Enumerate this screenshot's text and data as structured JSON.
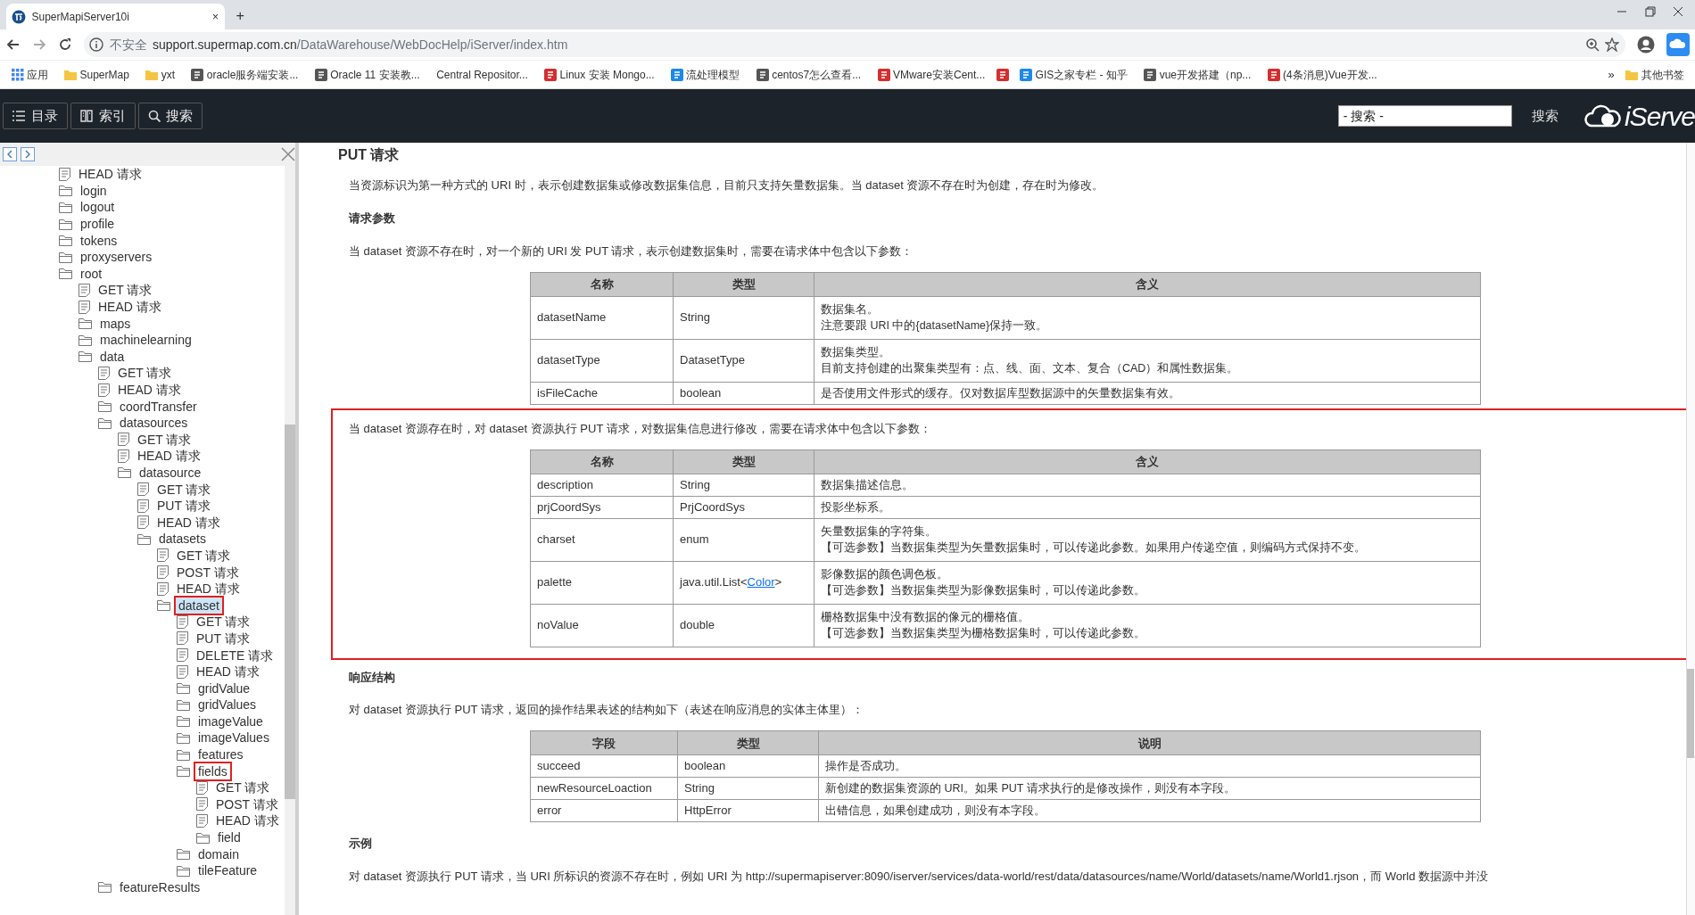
{
  "browser": {
    "tab": {
      "title": "SuperMapiServer10i",
      "close": "×",
      "new_tab": "+"
    },
    "address": {
      "security": "不安全",
      "host": "support.supermap.com.cn",
      "path": "/DataWarehouse/WebDocHelp/iServer/index.htm"
    },
    "bookmarks": [
      {
        "label": "应用",
        "kind": "apps"
      },
      {
        "label": "SuperMap",
        "kind": "folder"
      },
      {
        "label": "yxt",
        "kind": "folder"
      },
      {
        "label": "oracle服务端安装...",
        "kind": "gray"
      },
      {
        "label": "Oracle 11 安装教...",
        "kind": "gray"
      },
      {
        "label": "Central Repositor...",
        "kind": "none"
      },
      {
        "label": "Linux 安装 Mongo...",
        "kind": "red"
      },
      {
        "label": "流处理模型",
        "kind": "blue"
      },
      {
        "label": "centos7怎么查看...",
        "kind": "gray"
      },
      {
        "label": "VMware安装Cent...",
        "kind": "red"
      },
      {
        "kind": "red"
      },
      {
        "label": "GIS之家专栏 - 知乎",
        "kind": "blue"
      },
      {
        "label": "vue开发搭建（np...",
        "kind": "gray"
      },
      {
        "label": "(4条消息)Vue开发...",
        "kind": "red"
      }
    ],
    "more": "»",
    "other_bookmarks": "其他书签"
  },
  "toolbar": {
    "buttons": [
      {
        "label": "目录",
        "kind": "list"
      },
      {
        "label": "索引",
        "kind": "book"
      },
      {
        "label": "搜索",
        "kind": "search"
      }
    ],
    "search": {
      "placeholder": "- 搜索 -"
    },
    "search_button": "搜索",
    "logo": "iServe"
  },
  "sidebar": {
    "tree": [
      {
        "label": "HEAD 请求",
        "kind": "doc",
        "selected": false,
        "annotated": false
      },
      {
        "label": "login",
        "kind": "folder",
        "selected": false,
        "annotated": false
      },
      {
        "label": "logout",
        "kind": "folder",
        "selected": false,
        "annotated": false
      },
      {
        "label": "profile",
        "kind": "folder",
        "selected": false,
        "annotated": false
      },
      {
        "label": "tokens",
        "kind": "folder",
        "selected": false,
        "annotated": false
      },
      {
        "label": "proxyservers",
        "kind": "folder",
        "selected": false,
        "annotated": false
      },
      {
        "label": "root",
        "kind": "folder",
        "selected": false,
        "annotated": false,
        "children": [
          {
            "label": "GET 请求",
            "kind": "doc",
            "selected": false,
            "annotated": false
          },
          {
            "label": "HEAD 请求",
            "kind": "doc",
            "selected": false,
            "annotated": false
          },
          {
            "label": "maps",
            "kind": "folder",
            "selected": false,
            "annotated": false
          },
          {
            "label": "machinelearning",
            "kind": "folder",
            "selected": false,
            "annotated": false
          },
          {
            "label": "data",
            "kind": "folder",
            "selected": false,
            "annotated": false,
            "children": [
              {
                "label": "GET 请求",
                "kind": "doc",
                "selected": false,
                "annotated": false
              },
              {
                "label": "HEAD 请求",
                "kind": "doc",
                "selected": false,
                "annotated": false
              },
              {
                "label": "coordTransfer",
                "kind": "folder",
                "selected": false,
                "annotated": false
              },
              {
                "label": "datasources",
                "kind": "folder",
                "selected": false,
                "annotated": false,
                "children": [
                  {
                    "label": "GET 请求",
                    "kind": "doc",
                    "selected": false,
                    "annotated": false
                  },
                  {
                    "label": "HEAD 请求",
                    "kind": "doc",
                    "selected": false,
                    "annotated": false
                  },
                  {
                    "label": "datasource",
                    "kind": "folder",
                    "selected": false,
                    "annotated": false,
                    "children": [
                      {
                        "label": "GET 请求",
                        "kind": "doc",
                        "selected": false,
                        "annotated": false
                      },
                      {
                        "label": "PUT 请求",
                        "kind": "doc",
                        "selected": false,
                        "annotated": false
                      },
                      {
                        "label": "HEAD 请求",
                        "kind": "doc",
                        "selected": false,
                        "annotated": false
                      },
                      {
                        "label": "datasets",
                        "kind": "folder",
                        "selected": false,
                        "annotated": false,
                        "children": [
                          {
                            "label": "GET 请求",
                            "kind": "doc",
                            "selected": false,
                            "annotated": false
                          },
                          {
                            "label": "POST 请求",
                            "kind": "doc",
                            "selected": false,
                            "annotated": false
                          },
                          {
                            "label": "HEAD 请求",
                            "kind": "doc",
                            "selected": false,
                            "annotated": false
                          },
                          {
                            "label": "dataset",
                            "kind": "folder",
                            "selected": true,
                            "annotated": true,
                            "children": [
                              {
                                "label": "GET 请求",
                                "kind": "doc",
                                "selected": false,
                                "annotated": false
                              },
                              {
                                "label": "PUT 请求",
                                "kind": "doc",
                                "selected": false,
                                "annotated": false
                              },
                              {
                                "label": "DELETE 请求",
                                "kind": "doc",
                                "selected": false,
                                "annotated": false
                              },
                              {
                                "label": "HEAD 请求",
                                "kind": "doc",
                                "selected": false,
                                "annotated": false
                              },
                              {
                                "label": "gridValue",
                                "kind": "folder",
                                "selected": false,
                                "annotated": false
                              },
                              {
                                "label": "gridValues",
                                "kind": "folder",
                                "selected": false,
                                "annotated": false
                              },
                              {
                                "label": "imageValue",
                                "kind": "folder",
                                "selected": false,
                                "annotated": false
                              },
                              {
                                "label": "imageValues",
                                "kind": "folder",
                                "selected": false,
                                "annotated": false
                              },
                              {
                                "label": "features",
                                "kind": "folder",
                                "selected": false,
                                "annotated": false
                              },
                              {
                                "label": "fields",
                                "kind": "folder",
                                "selected": false,
                                "annotated": true,
                                "children": [
                                  {
                                    "label": "GET 请求",
                                    "kind": "doc",
                                    "selected": false,
                                    "annotated": false
                                  },
                                  {
                                    "label": "POST 请求",
                                    "kind": "doc",
                                    "selected": false,
                                    "annotated": false
                                  },
                                  {
                                    "label": "HEAD 请求",
                                    "kind": "doc",
                                    "selected": false,
                                    "annotated": false
                                  },
                                  {
                                    "label": "field",
                                    "kind": "folder",
                                    "selected": false,
                                    "annotated": false
                                  }
                                ]
                              },
                              {
                                "label": "domain",
                                "kind": "folder",
                                "selected": false,
                                "annotated": false
                              },
                              {
                                "label": "tileFeature",
                                "kind": "folder",
                                "selected": false,
                                "annotated": false
                              }
                            ]
                          }
                        ]
                      }
                    ]
                  }
                ]
              },
              {
                "label": "featureResults",
                "kind": "folder",
                "selected": false,
                "annotated": false
              }
            ]
          }
        ]
      }
    ]
  },
  "content": {
    "title": "PUT 请求",
    "blocks": [
      {
        "kind": "paragraph",
        "text": "当资源标识为第一种方式的 URI 时，表示创建数据集或修改数据集信息，目前只支持矢量数据集。当 dataset 资源不存在时为创建，存在时为修改。"
      },
      {
        "kind": "heading",
        "text": "请求参数"
      },
      {
        "kind": "paragraph",
        "text": "当 dataset 资源不存在时，对一个新的 URI 发 PUT 请求，表示创建数据集时，需要在请求体中包含以下参数："
      },
      {
        "kind": "table",
        "columns": [
          "名称",
          "类型",
          "含义"
        ],
        "rows": [
          {
            "name": "datasetName",
            "type": "String",
            "meaning": [
              "数据集名。",
              "注意要跟 URI 中的{datasetName}保持一致。"
            ]
          },
          {
            "name": "datasetType",
            "type": "DatasetType",
            "meaning": [
              "数据集类型。",
              "目前支持创建的出聚集类型有：点、线、面、文本、复合（CAD）和属性数据集。"
            ]
          },
          {
            "name": "isFileCache",
            "type": "boolean",
            "meaning": [
              "是否使用文件形式的缓存。仅对数据库型数据源中的矢量数据集有效。"
            ]
          }
        ]
      },
      {
        "kind": "section",
        "annotated": true,
        "blocks": [
          {
            "kind": "paragraph",
            "text": "当 dataset 资源存在时，对 dataset 资源执行 PUT 请求，对数据集信息进行修改，需要在请求体中包含以下参数："
          },
          {
            "kind": "table",
            "columns": [
              "名称",
              "类型",
              "含义"
            ],
            "rows": [
              {
                "name": "description",
                "type": "String",
                "meaning": [
                  "数据集描述信息。"
                ]
              },
              {
                "name": "prjCoordSys",
                "type": "PrjCoordSys",
                "meaning": [
                  "投影坐标系。"
                ]
              },
              {
                "name": "charset",
                "type": "enum",
                "meaning": [
                  "矢量数据集的字符集。",
                  "【可选参数】当数据集类型为矢量数据集时，可以传递此参数。如果用户传递空值，则编码方式保持不变。"
                ]
              },
              {
                "name": "palette",
                "type": "java.util.List<",
                "type_link": "Color",
                "type_suffix": ">",
                "meaning": [
                  "影像数据的颜色调色板。",
                  "【可选参数】当数据集类型为影像数据集时，可以传递此参数。"
                ]
              },
              {
                "name": "noValue",
                "type": "double",
                "meaning": [
                  "栅格数据集中没有数据的像元的栅格值。",
                  "【可选参数】当数据集类型为栅格数据集时，可以传递此参数。"
                ]
              }
            ]
          }
        ]
      },
      {
        "kind": "heading",
        "text": "响应结构"
      },
      {
        "kind": "paragraph",
        "text": "对 dataset 资源执行 PUT 请求，返回的操作结果表述的结构如下（表述在响应消息的实体主体里）："
      },
      {
        "kind": "table",
        "columns": [
          "字段",
          "类型",
          "说明"
        ],
        "rows": [
          {
            "name": "succeed",
            "type": "boolean",
            "meaning": [
              "操作是否成功。"
            ]
          },
          {
            "name": "newResourceLoaction",
            "type": "String",
            "meaning": [
              "新创建的数据集资源的 URI。如果 PUT 请求执行的是修改操作，则没有本字段。"
            ]
          },
          {
            "name": "error",
            "type": "HttpError",
            "meaning": [
              "出错信息，如果创建成功，则没有本字段。"
            ]
          }
        ]
      },
      {
        "kind": "heading",
        "text": "示例"
      },
      {
        "kind": "paragraph",
        "text": "对 dataset 资源执行 PUT 请求，当 URI 所标识的资源不存在时，例如 URI 为 http://supermapiserver:8090/iserver/services/data-world/rest/data/datasources/name/World/datasets/name/World1.rjson，而 World 数据源中并没"
      }
    ]
  }
}
